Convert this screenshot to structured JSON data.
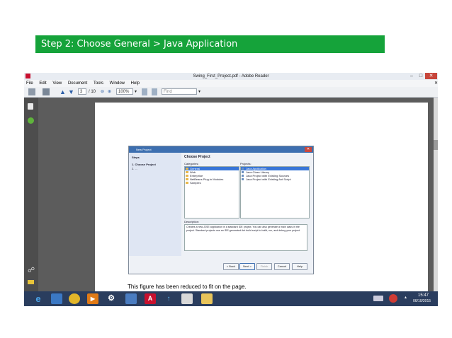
{
  "banner": {
    "text": "Step 2: Choose General > Java Application"
  },
  "reader": {
    "title": "Swing_First_Project.pdf - Adobe Reader",
    "menu": [
      "File",
      "Edit",
      "View",
      "Document",
      "Tools",
      "Window",
      "Help"
    ],
    "page_number": "3",
    "page_total": "/ 10",
    "zoom": "100%",
    "find_placeholder": "Find"
  },
  "dialog": {
    "title": "New Project",
    "heading": "Choose Project",
    "steps_label": "Steps",
    "steps": [
      "1.   Choose Project",
      "2.   ..."
    ],
    "categories_label": "Categories:",
    "categories": [
      "General",
      "Web",
      "Enterprise",
      "NetBeans Plug-in Modules",
      "Samples"
    ],
    "projects_label": "Projects:",
    "projects": [
      "Java Application",
      "Java Class Library",
      "Java Project with Existing Sources",
      "Java Project with Existing Ant Script"
    ],
    "description_label": "Description:",
    "description": "Creates a new J2SE application in a standard IDE project. You can also generate a main class in the project. Standard projects use an IDE-generated Ant build script to build, run, and debug your project.",
    "buttons": {
      "back": "< Back",
      "next": "Next >",
      "finish": "Finish",
      "cancel": "Cancel",
      "help": "Help"
    }
  },
  "caption": "This figure has been reduced to fit on the page.",
  "taskbar": {
    "time": "15:47",
    "date": "06/10/2015"
  }
}
